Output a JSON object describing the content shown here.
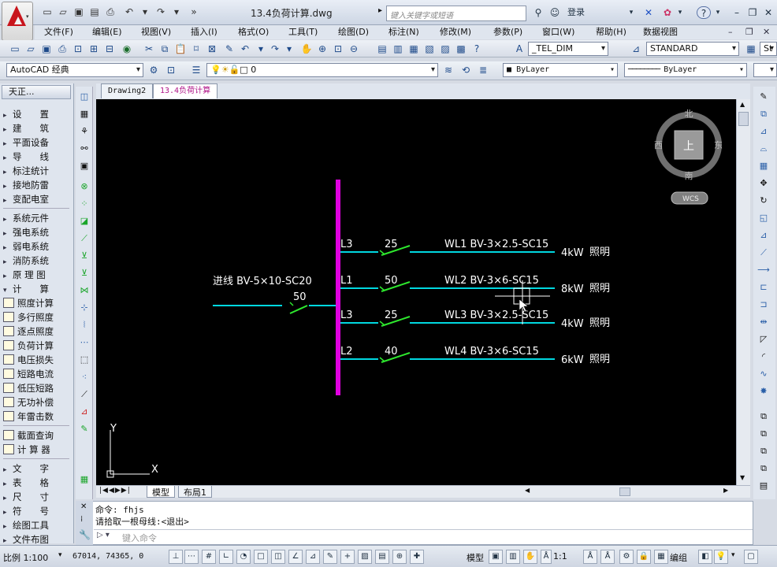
{
  "app": {
    "document_title": "13.4负荷计算.dwg",
    "search_placeholder": "键入关键字或短语",
    "login_label": "登录",
    "app_menu_caret": "▾"
  },
  "menu": [
    "文件(F)",
    "编辑(E)",
    "视图(V)",
    "插入(I)",
    "格式(O)",
    "工具(T)",
    "绘图(D)",
    "标注(N)",
    "修改(M)",
    "参数(P)",
    "窗口(W)",
    "帮助(H)",
    "数据视图"
  ],
  "toolbar2": {
    "dimstyle": "_TEL_DIM",
    "textstyle": "STANDARD",
    "extra": "St"
  },
  "toolbar3": {
    "workspace": "AutoCAD 经典",
    "layer": "0",
    "color": "ByLayer",
    "linetype": "ByLayer"
  },
  "left_panel": {
    "header": "天正...",
    "items": [
      {
        "label": "设　　置",
        "kind": "arrow"
      },
      {
        "label": "建　　筑",
        "kind": "arrow"
      },
      {
        "label": "平面设备",
        "kind": "arrow"
      },
      {
        "label": "导　　线",
        "kind": "arrow"
      },
      {
        "label": "标注统计",
        "kind": "arrow"
      },
      {
        "label": "接地防雷",
        "kind": "arrow"
      },
      {
        "label": "变配电室",
        "kind": "arrow"
      },
      {
        "label": "系统元件",
        "kind": "arrow"
      },
      {
        "label": "强电系统",
        "kind": "arrow"
      },
      {
        "label": "弱电系统",
        "kind": "arrow"
      },
      {
        "label": "消防系统",
        "kind": "arrow"
      },
      {
        "label": "原 理 图",
        "kind": "arrow"
      },
      {
        "label": "计　　算",
        "kind": "open"
      },
      {
        "label": "照度计算",
        "kind": "icon"
      },
      {
        "label": "多行照度",
        "kind": "icon"
      },
      {
        "label": "逐点照度",
        "kind": "icon"
      },
      {
        "label": "负荷计算",
        "kind": "icon"
      },
      {
        "label": "电压损失",
        "kind": "icon"
      },
      {
        "label": "短路电流",
        "kind": "icon"
      },
      {
        "label": "低压短路",
        "kind": "icon"
      },
      {
        "label": "无功补偿",
        "kind": "icon"
      },
      {
        "label": "年雷击数",
        "kind": "icon"
      },
      {
        "label": "截面查询",
        "kind": "icon"
      },
      {
        "label": "计 算 器",
        "kind": "icon"
      },
      {
        "label": "文　　字",
        "kind": "arrow"
      },
      {
        "label": "表　　格",
        "kind": "arrow"
      },
      {
        "label": "尺　　寸",
        "kind": "arrow"
      },
      {
        "label": "符　　号",
        "kind": "arrow"
      },
      {
        "label": "绘图工具",
        "kind": "arrow"
      },
      {
        "label": "文件布图",
        "kind": "arrow"
      }
    ]
  },
  "doc_tabs": [
    "Drawing2",
    "13.4负荷计算"
  ],
  "drawing": {
    "incoming": {
      "label": "进线 BV-5×10-SC20",
      "breaker": "50"
    },
    "circuits": [
      {
        "phase": "L3",
        "breaker": "25",
        "cable": "WL1 BV-3×2.5-SC15",
        "load": "4kW",
        "use": "照明"
      },
      {
        "phase": "L1",
        "breaker": "50",
        "cable": "WL2 BV-3×6-SC15",
        "load": "8kW",
        "use": "照明"
      },
      {
        "phase": "L3",
        "breaker": "25",
        "cable": "WL3 BV-3×2.5-SC15",
        "load": "4kW",
        "use": "照明"
      },
      {
        "phase": "L2",
        "breaker": "40",
        "cable": "WL4 BV-3×6-SC15",
        "load": "6kW",
        "use": "照明"
      }
    ],
    "ucs_y": "Y",
    "ucs_x": "X"
  },
  "viewcube": {
    "north": "北",
    "south": "南",
    "west": "西",
    "east": "东",
    "face": "上",
    "wcs": "WCS"
  },
  "layout_tabs": [
    "模型",
    "布局1"
  ],
  "command": {
    "line1": "命令: fhjs",
    "line2": "请拾取一根母线:<退出>",
    "placeholder": "键入命令"
  },
  "status": {
    "scale": "比例 1:100",
    "coords": "67014, 74365, 0",
    "model": "模型",
    "annoscale": "1:1",
    "group": "编组"
  },
  "colors": {
    "bus": "#e000e0",
    "wire": "#00d8e0",
    "breaker": "#2ee82e",
    "text": "#ffffff"
  }
}
